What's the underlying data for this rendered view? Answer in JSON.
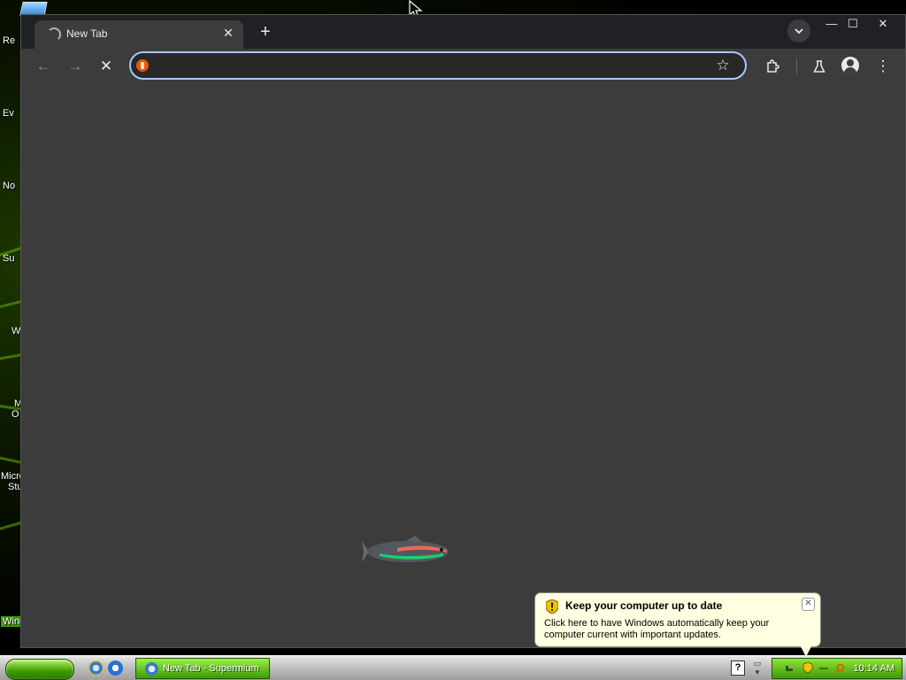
{
  "desktop": {
    "labels": [
      "Re",
      "Ev",
      "No",
      "Su",
      "W",
      "M",
      "O",
      "Micro",
      "Stu",
      "Wind"
    ]
  },
  "browser": {
    "tab": {
      "title": "New Tab",
      "close": "✕"
    },
    "newtab": "+",
    "tabsearch": "⌄",
    "window_buttons": {
      "minimize": "—",
      "maximize": "☐",
      "close": "✕"
    },
    "toolbar": {
      "back": "←",
      "forward": "→",
      "stop": "✕",
      "star": "☆",
      "extensions": "⧉",
      "labs": "⚗",
      "menu": "⋮"
    },
    "omnibox": {
      "value": "",
      "placeholder": ""
    }
  },
  "notification": {
    "title": "Keep your computer up to date",
    "text": "Click here to have Windows automatically keep your computer current with important updates.",
    "close": "✕",
    "accent": "#ffffe1"
  },
  "taskbar": {
    "task_label": "New Tab - Supermium",
    "help": "?",
    "clock": "10:14 AM"
  },
  "colors": {
    "browser_bg": "#3c3c3c",
    "tabstrip": "#202124",
    "omnibox_border": "#a8c7fa",
    "taskbar_green": "#3e9a06"
  }
}
